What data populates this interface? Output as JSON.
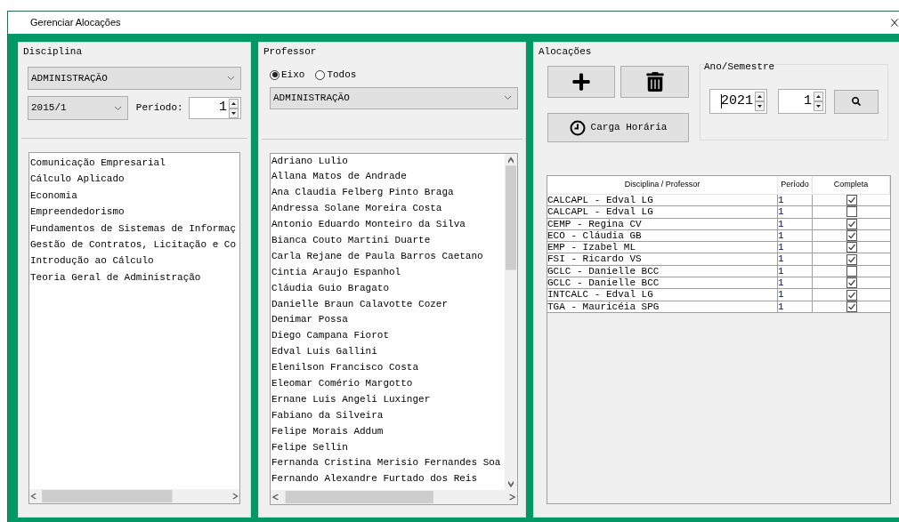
{
  "window": {
    "title": "Gerenciar Alocações"
  },
  "disciplina": {
    "title": "Disciplina",
    "curso": "ADMINISTRAÇÃO",
    "semestre": "2015/1",
    "periodo_label": "Período:",
    "periodo": "1",
    "items": [
      "Comunicação Empresarial",
      "Cálculo Aplicado",
      "Economia",
      "Empreendedorismo",
      "Fundamentos de Sistemas de Informaç",
      "Gestão de Contratos, Licitação e Co",
      "Introdução ao Cálculo",
      "Teoria Geral de Administração"
    ]
  },
  "professor": {
    "title": "Professor",
    "filters": [
      {
        "label": "Eixo",
        "selected": true
      },
      {
        "label": "Todos",
        "selected": false
      }
    ],
    "eixo": "ADMINISTRAÇÃO",
    "items": [
      "Adriano Lulio",
      "Allana Matos de Andrade",
      "Ana Claudia Felberg Pinto Braga",
      "Andressa Solane Moreira Costa",
      "Antonio Eduardo Monteiro da Silva",
      "Bianca Couto Martini Duarte",
      "Carla Rejane de Paula Barros Caetano",
      "Cintia Araujo Espanhol",
      "Cláudia Guio Bragato",
      "Danielle Braun Calavotte Cozer",
      "Denimar Possa",
      "Diego Campana Fiorot",
      "Edval Luis Gallini",
      "Elenilson Francisco Costa",
      "Eleomar Comério Margotto",
      "Ernane Luis Angeli Luxinger",
      "Fabiano da Silveira",
      "Felipe Morais Addum",
      "Felipe Sellin",
      "Fernanda Cristina Merisio Fernandes Soa",
      "Fernando Alexandre Furtado dos Reis"
    ]
  },
  "alocacoes": {
    "title": "Alocações",
    "carga_button": "Carga Horária",
    "ano_semestre": {
      "title": "Ano/Semestre",
      "ano": "2021",
      "semestre": "1"
    },
    "table": {
      "columns": [
        "Disciplina / Professor",
        "Período",
        "Completa"
      ],
      "rows": [
        {
          "disciplina_professor": "CALCAPL - Edval LG",
          "periodo": "1",
          "completa": true
        },
        {
          "disciplina_professor": "CALCAPL - Edval LG",
          "periodo": "1",
          "completa": false
        },
        {
          "disciplina_professor": "CEMP - Regina CV",
          "periodo": "1",
          "completa": true
        },
        {
          "disciplina_professor": "ECO - Cláudia GB",
          "periodo": "1",
          "completa": true
        },
        {
          "disciplina_professor": "EMP - Izabel ML",
          "periodo": "1",
          "completa": true
        },
        {
          "disciplina_professor": "FSI - Ricardo VS",
          "periodo": "1",
          "completa": true
        },
        {
          "disciplina_professor": "GCLC - Danielle BCC",
          "periodo": "1",
          "completa": false
        },
        {
          "disciplina_professor": "GCLC - Danielle BCC",
          "periodo": "1",
          "completa": true
        },
        {
          "disciplina_professor": "INTCALC - Edval LG",
          "periodo": "1",
          "completa": true
        },
        {
          "disciplina_professor": "TGA - Mauricéia SPG",
          "periodo": "1",
          "completa": true
        }
      ]
    }
  }
}
